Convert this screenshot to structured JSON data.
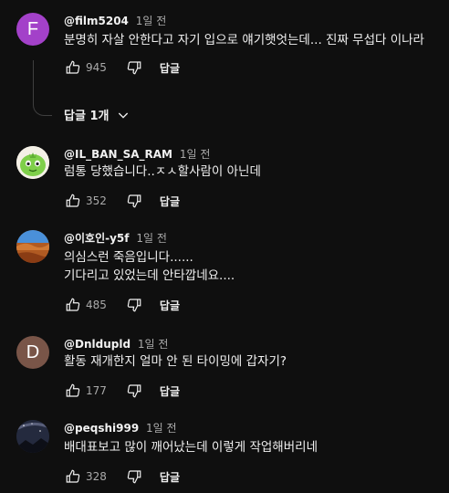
{
  "comments": [
    {
      "author": "@film5204",
      "time": "1일 전",
      "avatar_letter": "F",
      "avatar_color": "#a341c9",
      "lines": [
        "분명히 자살 안한다고 자기 입으로 얘기햇엇는데... 진짜 무섭다 이나라"
      ],
      "likes": "945",
      "reply_label": "답글"
    },
    {
      "author": "@IL_BAN_SA_RAM",
      "time": "1일 전",
      "lines": [
        "럼통 당했습니다..ㅈㅅ할사람이 아닌데"
      ],
      "likes": "352",
      "reply_label": "답글"
    },
    {
      "author": "@이호인-y5f",
      "time": "1일 전",
      "lines": [
        "의심스런 죽음입니다......",
        "기다리고 있었는데 안타깝네요...."
      ],
      "likes": "485",
      "reply_label": "답글"
    },
    {
      "author": "@Dnldupld",
      "time": "1일 전",
      "avatar_letter": "D",
      "avatar_color": "#795548",
      "lines": [
        "활동 재개한지 얼마 안 된 타이밍에 갑자기?"
      ],
      "likes": "177",
      "reply_label": "답글"
    },
    {
      "author": "@peqshi999",
      "time": "1일 전",
      "lines": [
        "배대표보고 많이 깨어났는데 이렇게 작업해버리네"
      ],
      "likes": "328",
      "reply_label": "답글"
    }
  ],
  "replies_toggle": "답글 1개"
}
